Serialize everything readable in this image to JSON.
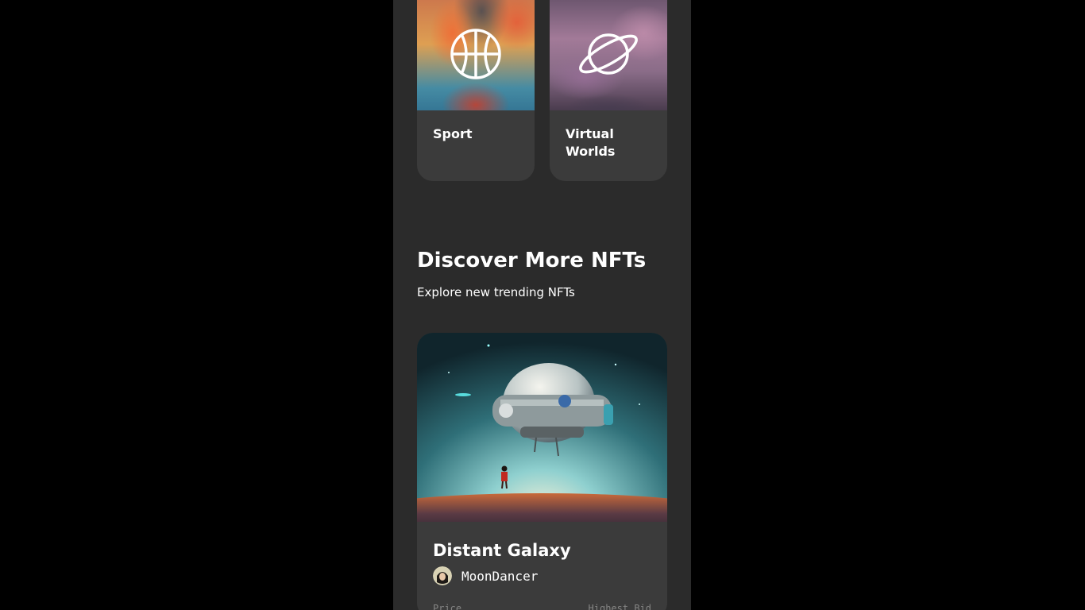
{
  "categories": [
    {
      "label": "Sport",
      "icon": "basketball-icon"
    },
    {
      "label": "Virtual Worlds",
      "icon": "planet-icon"
    }
  ],
  "discover": {
    "title": "Discover More NFTs",
    "subtitle": "Explore new trending NFTs"
  },
  "nft": {
    "title": "Distant Galaxy",
    "artist": "MoonDancer",
    "price_label": "Price",
    "bid_label": "Highest Bid"
  },
  "colors": {
    "background": "#000000",
    "panel": "#2b2b2b",
    "card": "#3b3b3b",
    "muted_text": "#858584"
  }
}
